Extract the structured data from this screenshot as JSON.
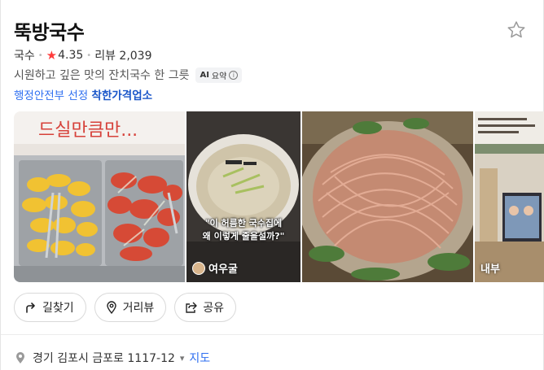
{
  "place": {
    "name": "뚝방국수",
    "category": "국수",
    "rating": "4.35",
    "review_label": "리뷰 2,039",
    "description": "시원하고 깊은 맛의 잔치국수 한 그릇",
    "ai_badge": {
      "prefix": "AI",
      "label": "요약"
    },
    "certification": {
      "prefix": "행정안전부 선정 ",
      "highlight": "착한가격업소"
    }
  },
  "photos": [
    {
      "name": "food-photo",
      "label": "",
      "overlay_text": "드실만큼만..."
    },
    {
      "name": "blog-photo",
      "label": "여우굴",
      "quote_line1": "\"이 허름한 국수집에",
      "quote_line2": "왜 이렇게 줄을설까?\""
    },
    {
      "name": "noodle-photo",
      "label": ""
    },
    {
      "name": "interior-photo",
      "label": "내부"
    }
  ],
  "actions": [
    {
      "label": "길찾기",
      "icon": "directions-icon"
    },
    {
      "label": "거리뷰",
      "icon": "streetview-pin-icon"
    },
    {
      "label": "공유",
      "icon": "share-icon"
    }
  ],
  "address": {
    "text": "경기 김포시 금포로 1117-12",
    "map_link": "지도"
  },
  "colors": {
    "accent": "#2d6ef0",
    "rating_star": "#ff3b3b"
  }
}
